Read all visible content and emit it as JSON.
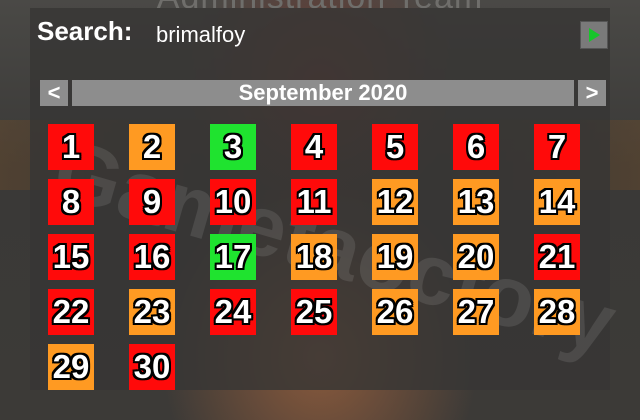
{
  "window": {
    "title": "Administration Team"
  },
  "watermark": "Gametaoctory",
  "search": {
    "label": "Search:",
    "value": "brimalfoy",
    "go_icon": "play-icon"
  },
  "calendar": {
    "prev_label": "<",
    "next_label": ">",
    "month_label": "September 2020",
    "status_colors": {
      "red": "#ff0a0a",
      "orange": "#ff9a22",
      "green": "#1fe32f"
    },
    "days": [
      {
        "d": "1",
        "s": "red"
      },
      {
        "d": "2",
        "s": "orange"
      },
      {
        "d": "3",
        "s": "green"
      },
      {
        "d": "4",
        "s": "red"
      },
      {
        "d": "5",
        "s": "red"
      },
      {
        "d": "6",
        "s": "red"
      },
      {
        "d": "7",
        "s": "red"
      },
      {
        "d": "8",
        "s": "red"
      },
      {
        "d": "9",
        "s": "red"
      },
      {
        "d": "10",
        "s": "red"
      },
      {
        "d": "11",
        "s": "red"
      },
      {
        "d": "12",
        "s": "orange"
      },
      {
        "d": "13",
        "s": "orange"
      },
      {
        "d": "14",
        "s": "orange"
      },
      {
        "d": "15",
        "s": "red"
      },
      {
        "d": "16",
        "s": "red"
      },
      {
        "d": "17",
        "s": "green"
      },
      {
        "d": "18",
        "s": "orange"
      },
      {
        "d": "19",
        "s": "orange"
      },
      {
        "d": "20",
        "s": "orange"
      },
      {
        "d": "21",
        "s": "red"
      },
      {
        "d": "22",
        "s": "red"
      },
      {
        "d": "23",
        "s": "orange"
      },
      {
        "d": "24",
        "s": "red"
      },
      {
        "d": "25",
        "s": "red"
      },
      {
        "d": "26",
        "s": "orange"
      },
      {
        "d": "27",
        "s": "orange"
      },
      {
        "d": "28",
        "s": "orange"
      },
      {
        "d": "29",
        "s": "orange"
      },
      {
        "d": "30",
        "s": "red"
      }
    ]
  }
}
